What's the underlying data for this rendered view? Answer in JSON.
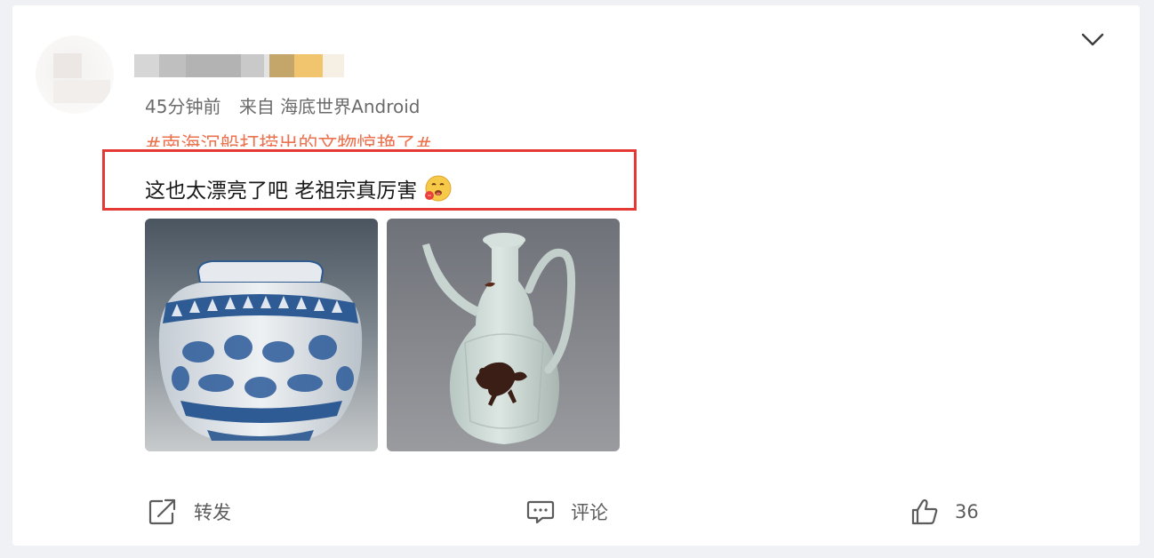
{
  "post": {
    "time": "45分钟前",
    "source": "来自 海底世界Android",
    "topic": "#南海沉船打捞出的文物惊艳了#",
    "text": "这也太漂亮了吧 老祖宗真厉害"
  },
  "actions": {
    "forward_label": "转发",
    "comment_label": "评论",
    "like_count": "36"
  },
  "colors": {
    "topic": "#eb7350",
    "highlight_border": "#e53935",
    "text": "#1a1a1a",
    "meta": "#6b6b6b"
  },
  "icons": {
    "menu": "chevron-down-icon",
    "forward": "share-icon",
    "comment": "comment-icon",
    "like": "thumbs-up-icon",
    "emoji": "drooling-emoji"
  }
}
